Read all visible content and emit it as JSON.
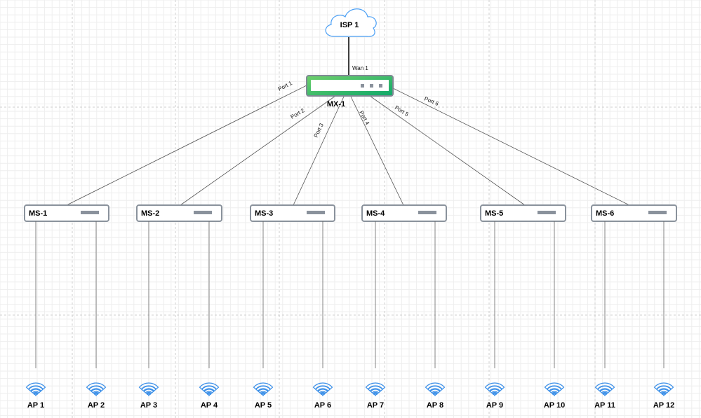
{
  "isp": {
    "label": "ISP 1",
    "icon": "cloud-icon"
  },
  "wan_link": {
    "label": "Wan 1"
  },
  "firewall": {
    "label": "MX-1",
    "icon": "security-appliance-icon"
  },
  "ports": [
    "Port 1",
    "Port 2",
    "Port 3",
    "Port 4",
    "Port 5",
    "Port 6"
  ],
  "switches": [
    "MS-1",
    "MS-2",
    "MS-3",
    "MS-4",
    "MS-5",
    "MS-6"
  ],
  "access_points": [
    "AP 1",
    "AP 2",
    "AP 3",
    "AP 4",
    "AP 5",
    "AP 6",
    "AP 7",
    "AP 8",
    "AP 9",
    "AP 10",
    "AP 11",
    "AP 12"
  ],
  "colors": {
    "cloud_stroke": "#4a9ff5",
    "firewall_green": "#2eb85c",
    "switch_border": "#8a929c",
    "ap_blue": "#3b8fe8",
    "grid": "#ececec"
  }
}
